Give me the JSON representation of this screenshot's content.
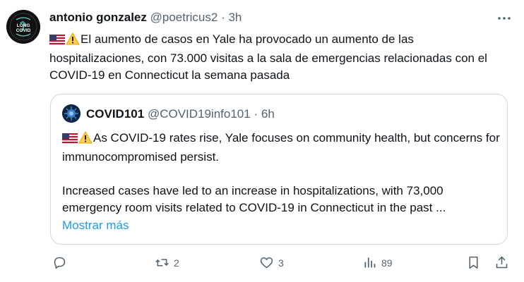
{
  "tweet": {
    "author_name": "antonio gonzalez",
    "author_handle": "@poetricus2",
    "separator": "·",
    "time": "3h",
    "avatar_text": "LONG COVID",
    "text": "El aumento de casos  en Yale ha provocado un aumento de las hospitalizaciones, con 73.000 visitas a la sala de emergencias relacionadas con el COVID-19 en Connecticut la semana pasada"
  },
  "quote": {
    "author_name": "COVID101",
    "author_handle": "@COVID19info101",
    "separator": "·",
    "time": "6h",
    "paragraph1": "As COVID-19 rates rise, Yale focuses on community health, but concerns for immunocompromised persist.",
    "paragraph2": "Increased cases have led to an increase in hospitalizations, with 73,000 emergency room visits related to COVID-19 in Connecticut in the past ...",
    "show_more": "Mostrar más"
  },
  "actions": {
    "replies": "",
    "retweets": "2",
    "likes": "3",
    "views": "89"
  },
  "colors": {
    "text": "#0f1419",
    "secondary": "#536471",
    "link": "#1d9bf0",
    "border": "#cfd9de"
  },
  "icons": [
    "us-flag-icon",
    "warning-icon",
    "more-icon",
    "reply-icon",
    "retweet-icon",
    "like-icon",
    "views-icon",
    "bookmark-icon",
    "share-icon"
  ]
}
